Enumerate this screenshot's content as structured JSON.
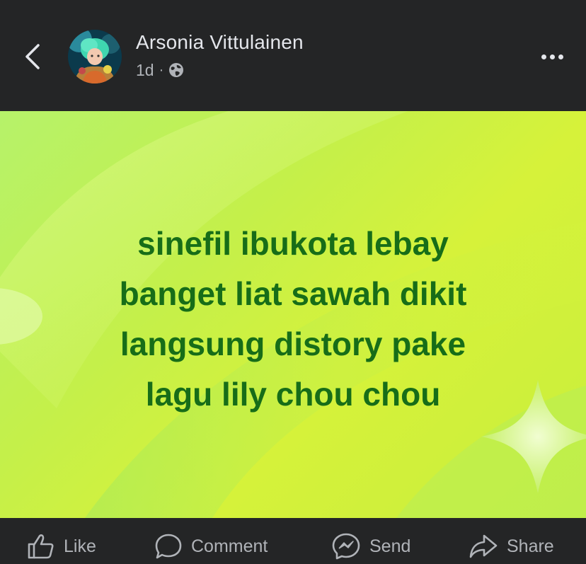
{
  "header": {
    "author_name": "Arsonia Vittulainen",
    "time": "1d",
    "separator": "·",
    "icons": {
      "back": "chevron-left-icon",
      "privacy": "globe-icon",
      "more": "more-horizontal-icon"
    }
  },
  "post": {
    "text": "sinefil ibukota lebay\nbanget liat sawah dikit\nlangsung distory pake\nlagu lily chou chou",
    "text_color": "#176d18",
    "background_colors": [
      "#b6f26a",
      "#c4f04a",
      "#d6f23a"
    ]
  },
  "actions": {
    "like": {
      "label": "Like",
      "icon": "thumbs-up-icon"
    },
    "comment": {
      "label": "Comment",
      "icon": "comment-icon"
    },
    "send": {
      "label": "Send",
      "icon": "messenger-icon"
    },
    "share": {
      "label": "Share",
      "icon": "share-arrow-icon"
    }
  },
  "colors": {
    "bar_background": "#242526",
    "primary_text": "#e4e6eb",
    "secondary_text": "#b0b3b8"
  }
}
